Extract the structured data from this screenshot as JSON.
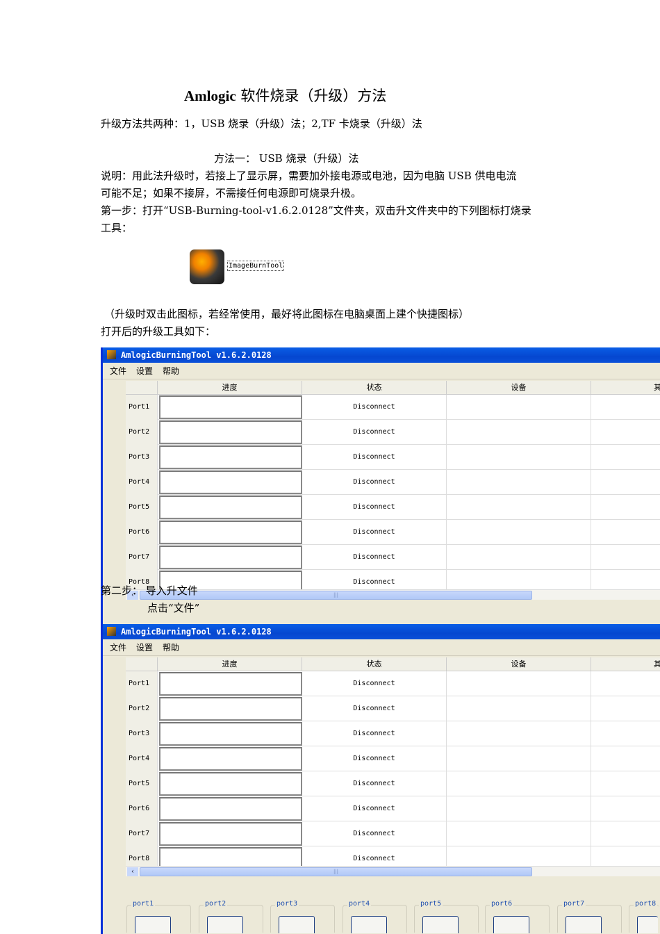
{
  "doc": {
    "title_latin": "Amlogic",
    "title_cn": " 软件烧录（升级）方法",
    "intro": "升级方法共两种：1，USB 烧录（升级）法；2,TF 卡烧录（升级）法",
    "method1_heading": "方法一： USB  烧录（升级）法",
    "note_line1": "说明：用此法升级时，若接上了显示屏，需要加外接电源或电池，因为电脑  USB 供电电流",
    "note_line2": "可能不足；如果不接屏，不需接任何电源即可烧录升极。",
    "step1_line1": "第一步：打开“USB-Burning-tool-v1.6.2.0128”文件夹，双击升文件夹中的下列图标打烧录",
    "step1_line2": "工具：",
    "icon_label": "ImageBurnTool",
    "tip": "（升级时双击此图标，若经常使用，最好将此图标在电脑桌面上建个快捷图标）",
    "after_open": "打开后的升级工具如下：",
    "step2": "第二步：  导入升文件",
    "step2_sub": "点击“文件”"
  },
  "app": {
    "title": "AmlogicBurningTool   v1.6.2.0128",
    "menu": [
      "文件",
      "设置",
      "帮助"
    ],
    "columns": [
      "进度",
      "状态",
      "设备",
      "其"
    ],
    "rows": [
      {
        "port": "Port1",
        "status": "Disconnect"
      },
      {
        "port": "Port2",
        "status": "Disconnect"
      },
      {
        "port": "Port3",
        "status": "Disconnect"
      },
      {
        "port": "Port4",
        "status": "Disconnect"
      },
      {
        "port": "Port5",
        "status": "Disconnect"
      },
      {
        "port": "Port6",
        "status": "Disconnect"
      },
      {
        "port": "Port7",
        "status": "Disconnect"
      },
      {
        "port": "Port8",
        "status": "Disconnect"
      }
    ],
    "port_groups": [
      "port1",
      "port2",
      "port3",
      "port4",
      "port5",
      "port6",
      "port7",
      "port8"
    ]
  }
}
